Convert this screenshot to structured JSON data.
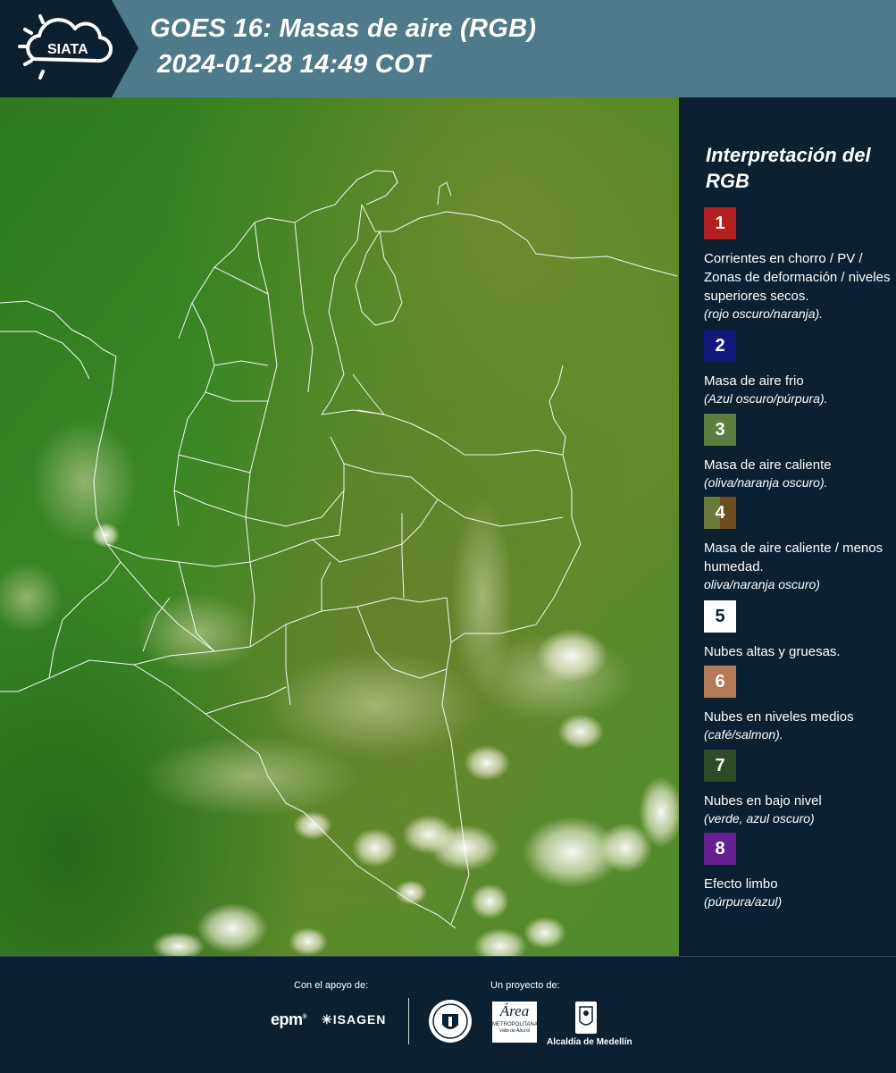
{
  "header": {
    "logo_text": "SIATA",
    "title_line1": "GOES 16: Masas de aire (RGB)",
    "title_line2": "2024-01-28 14:49 COT"
  },
  "legend": {
    "heading": "Interpretación del RGB",
    "items": [
      {
        "number": "1",
        "color": "#b3201f",
        "description": "Corrientes en chorro / PV / Zonas de deformación / niveles superiores secos.",
        "note": "(rojo oscuro/naranja)."
      },
      {
        "number": "2",
        "color": "#101a7a",
        "description": "Masa de aire frio",
        "note": "(Azul oscuro/púrpura)."
      },
      {
        "number": "3",
        "color": "#5d7d3e",
        "description": "Masa de aire caliente",
        "note": "(oliva/naranja oscuro)."
      },
      {
        "number": "4",
        "color": "#6e5a2c",
        "description": "Masa de aire caliente / menos humedad.",
        "note": "oliva/naranja oscuro)"
      },
      {
        "number": "5",
        "color": "#ffffff",
        "description": "Nubes altas y gruesas.",
        "note": ""
      },
      {
        "number": "6",
        "color": "#b47a5a",
        "description": "Nubes en niveles medios",
        "note": "(café/salmon)."
      },
      {
        "number": "7",
        "color": "#2f4a26",
        "description": "Nubes en bajo nivel",
        "note": "(verde, azul oscuro)"
      },
      {
        "number": "8",
        "color": "#65228f",
        "description": "Efecto limbo",
        "note": "(púrpura/azul)"
      }
    ]
  },
  "footer": {
    "support_label": "Con el apoyo de:",
    "project_label": "Un proyecto de:",
    "sponsor_1": "epm",
    "sponsor_2": "ISAGEN",
    "partner_1_line1": "Área",
    "partner_1_line2": "METROPOLITANA",
    "partner_1_line3": "Valle de Aburrá",
    "partner_2": "Alcaldía de Medellín"
  }
}
